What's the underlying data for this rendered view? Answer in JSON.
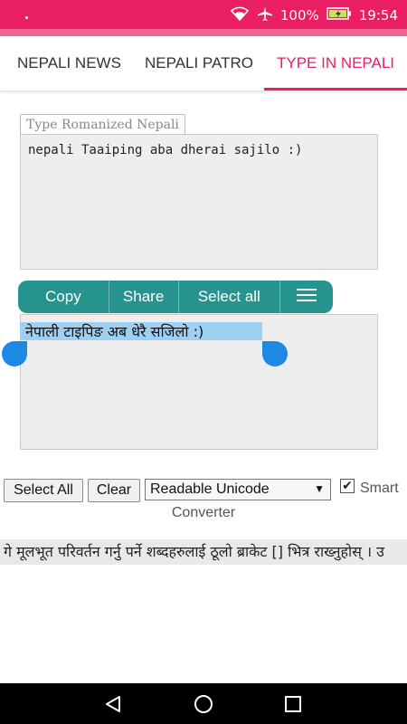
{
  "status": {
    "battery_percent": "100%",
    "time": "19:54"
  },
  "tabs": [
    {
      "label": "NEPALI NEWS",
      "active": false
    },
    {
      "label": "NEPALI PATRO",
      "active": false
    },
    {
      "label": "TYPE IN NEPALI",
      "active": true
    }
  ],
  "input_box": {
    "legend": "Type Romanized Nepali",
    "value": "nepali Taaiping aba dherai sajilo :)"
  },
  "text_toolbar": {
    "copy": "Copy",
    "share": "Share",
    "select_all": "Select all"
  },
  "output_box": {
    "value": "नेपाली टाइपिङ अब धेरै सजिलो :)"
  },
  "controls": {
    "select_all": "Select All",
    "clear": "Clear",
    "encoding_selected": "Readable Unicode",
    "smart_converter_label_1": "Smart",
    "smart_converter_label_2": "Converter",
    "smart_checked": true
  },
  "marquee_text": "गे मूलभूत परिवर्तन गर्नु पर्ने शब्दहरुलाई ठूलो ब्राकेट [] भित्र राख्नुहोस् । उ",
  "colors": {
    "brand": "#e91e63",
    "toolbar": "#26938f",
    "handle": "#1e88e5",
    "selection": "#9fd0f2"
  }
}
